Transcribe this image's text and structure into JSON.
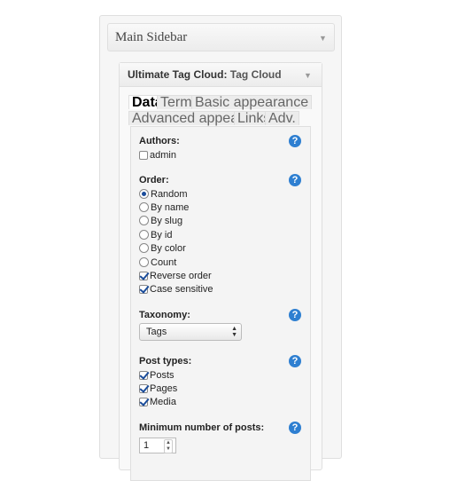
{
  "sidebar": {
    "title": "Main Sidebar"
  },
  "widget": {
    "title_prefix": "Ultimate Tag Cloud:",
    "title_name": "Tag Cloud"
  },
  "tabs": [
    {
      "label": "Data",
      "active": true
    },
    {
      "label": "Terms",
      "active": false
    },
    {
      "label": "Basic appearance",
      "active": false
    },
    {
      "label": "Advanced appearance",
      "active": false
    },
    {
      "label": "Links",
      "active": false
    },
    {
      "label": "Adv.",
      "active": false
    }
  ],
  "help_icon": "?",
  "authors": {
    "label": "Authors:",
    "options": [
      {
        "label": "admin",
        "checked": false
      }
    ]
  },
  "order": {
    "label": "Order:",
    "radios": [
      {
        "label": "Random",
        "checked": true
      },
      {
        "label": "By name",
        "checked": false
      },
      {
        "label": "By slug",
        "checked": false
      },
      {
        "label": "By id",
        "checked": false
      },
      {
        "label": "By color",
        "checked": false
      },
      {
        "label": "Count",
        "checked": false
      }
    ],
    "checkboxes": [
      {
        "label": "Reverse order",
        "checked": true
      },
      {
        "label": "Case sensitive",
        "checked": true
      }
    ]
  },
  "taxonomy": {
    "label": "Taxonomy:",
    "selected": "Tags"
  },
  "post_types": {
    "label": "Post types:",
    "options": [
      {
        "label": "Posts",
        "checked": true
      },
      {
        "label": "Pages",
        "checked": true
      },
      {
        "label": "Media",
        "checked": true
      }
    ]
  },
  "min_posts": {
    "label": "Minimum number of posts:",
    "value": "1"
  }
}
